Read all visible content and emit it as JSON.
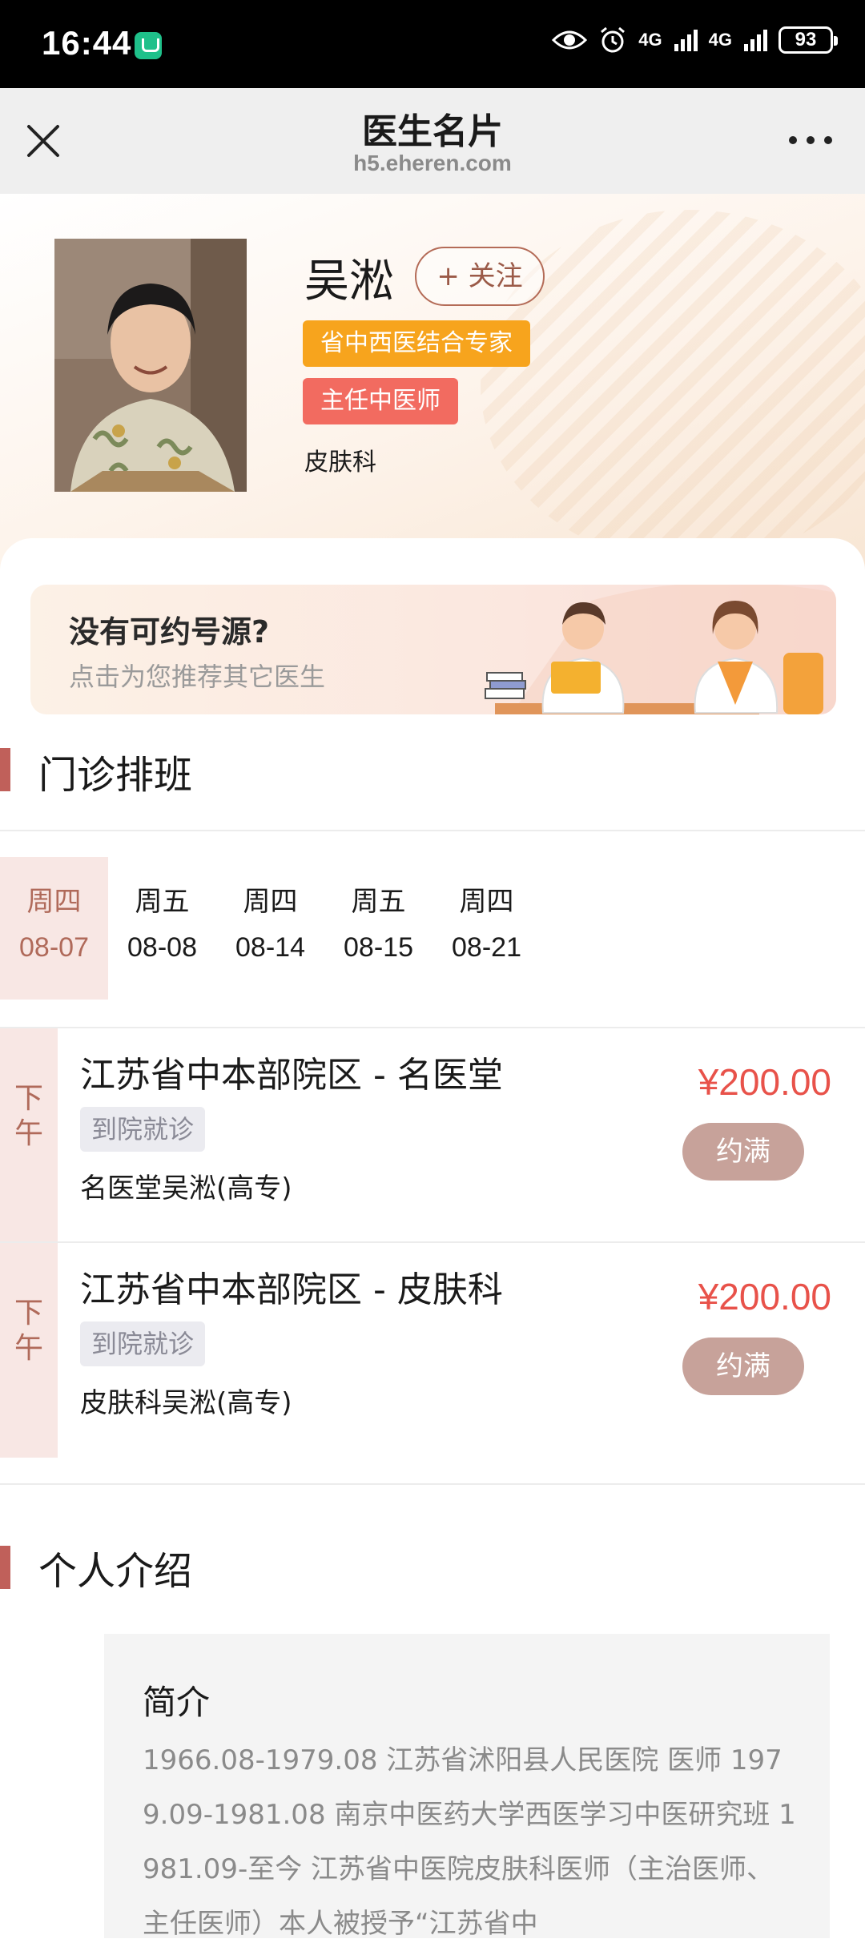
{
  "status_bar": {
    "time": "16:44",
    "net1": "4G",
    "net2": "4G",
    "battery": "93"
  },
  "nav": {
    "title": "医生名片",
    "subtitle": "h5.eheren.com"
  },
  "doctor": {
    "name": "吴淞",
    "follow_label": "+ 关注",
    "tag_expert": "省中西医结合专家",
    "tag_title": "主任中医师",
    "department": "皮肤科"
  },
  "banner": {
    "title": "没有可约号源?",
    "subtitle": "点击为您推荐其它医生"
  },
  "schedule_section": {
    "title": "门诊排班"
  },
  "dates": [
    {
      "day": "周四",
      "date": "08-07"
    },
    {
      "day": "周五",
      "date": "08-08"
    },
    {
      "day": "周四",
      "date": "08-14"
    },
    {
      "day": "周五",
      "date": "08-15"
    },
    {
      "day": "周四",
      "date": "08-21"
    }
  ],
  "slots": [
    {
      "period": "下午",
      "location": "江苏省中本部院区 - 名医堂",
      "tag": "到院就诊",
      "desc": "名医堂吴淞(高专)",
      "price": "¥200.00",
      "status": "约满"
    },
    {
      "period": "下午",
      "location": "江苏省中本部院区 - 皮肤科",
      "tag": "到院就诊",
      "desc": "皮肤科吴淞(高专)",
      "price": "¥200.00",
      "status": "约满"
    }
  ],
  "intro_section": {
    "title": "个人介绍",
    "heading": "简介",
    "text": "1966.08-1979.08 江苏省沭阳县人民医院 医师 1979.09-1981.08 南京中医药大学西医学习中医研究班 1981.09-至今 江苏省中医院皮肤科医师（主治医师、主任医师）本人被授予“江苏省中"
  },
  "colors": {
    "accent": "#c0605a",
    "price": "#e8524a",
    "tag_orange": "#f7a41d",
    "tag_red": "#f26b60"
  }
}
